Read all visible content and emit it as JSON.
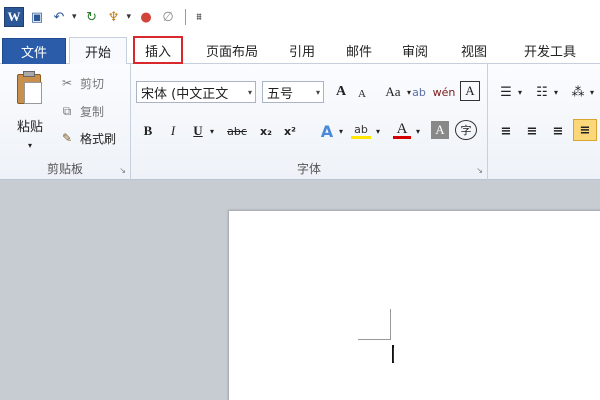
{
  "qat": {
    "app_letter": "W",
    "save_glyph": "▣",
    "undo_glyph": "↶",
    "redo_glyph": "↻",
    "brush_glyph": "♆",
    "color_glyph": "●",
    "clear_glyph": "∅",
    "dropdown_glyph": "▾",
    "customize_glyph": "⩩"
  },
  "tabs": {
    "file": "文件",
    "home": "开始",
    "insert": "插入",
    "layout": "页面布局",
    "references": "引用",
    "mailings": "邮件",
    "review": "审阅",
    "view": "视图",
    "developer": "开发工具"
  },
  "clipboard": {
    "group_label": "剪贴板",
    "paste": "粘贴",
    "cut": "剪切",
    "copy": "复制",
    "format_painter": "格式刷",
    "paste_dd": "▾",
    "launcher": "↘"
  },
  "font": {
    "group_label": "字体",
    "font_name": "宋体 (中文正文",
    "font_size": "五号",
    "grow": "A",
    "shrink": "A",
    "change_case": "Aa",
    "clear_format": "ab",
    "phonetic": "wén",
    "char_border": "A",
    "bold": "B",
    "italic": "I",
    "underline": "U",
    "strike": "abc",
    "subscript": "x₂",
    "superscript": "x²",
    "effects": "A",
    "highlight": "ab",
    "font_color": "A",
    "char_shading": "A",
    "enclose": "字",
    "dd": "▾",
    "launcher": "↘"
  },
  "paragraph": {
    "bullets": "☰",
    "numbering": "☷",
    "multilevel": "⁂",
    "align_left": "≡",
    "align_center": "≡",
    "align_right": "≡",
    "justify": "≡",
    "dd": "▾"
  },
  "colors": {
    "accent": "#2a5caa",
    "highlight_yellow": "#ffe600",
    "font_red": "#d40000",
    "insert_outline": "#d9272e"
  }
}
